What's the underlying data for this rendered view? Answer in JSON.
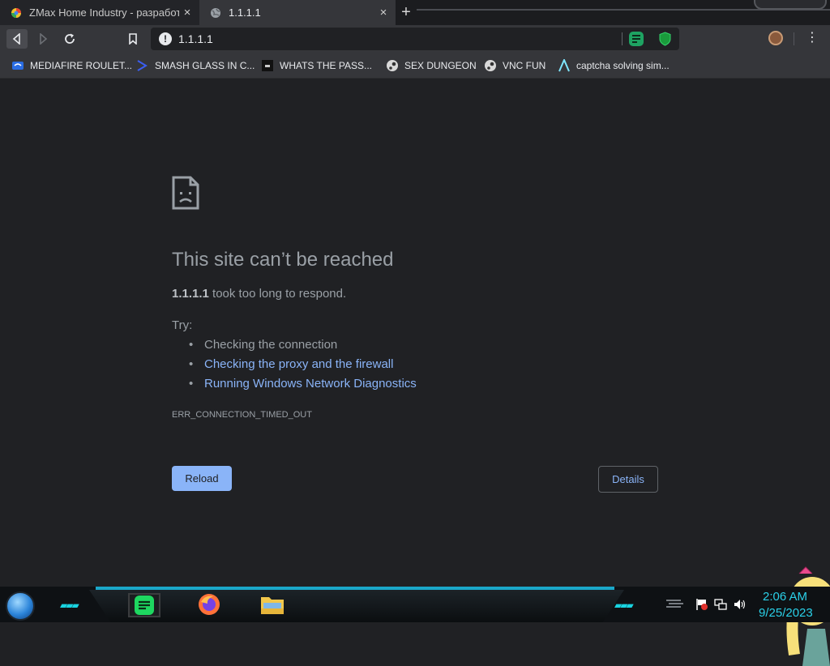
{
  "tabs": [
    {
      "title": "ZMax Home Industry - разработк",
      "close": "×",
      "favicon": "chrome-colorful-icon"
    },
    {
      "title": "1.1.1.1",
      "close": "×",
      "favicon": "globe-icon"
    }
  ],
  "new_tab": "+",
  "toolbar": {
    "url": "1.1.1.1",
    "security_icon": "!",
    "menu": "⋮"
  },
  "bookmarks": [
    {
      "label": "MEDIAFIRE ROULET...",
      "icon": "mediafire-icon"
    },
    {
      "label": "SMASH GLASS IN C...",
      "icon": "blue-arrow-icon"
    },
    {
      "label": "WHATS THE PASS...",
      "icon": "dark-app-icon"
    },
    {
      "label": "SEX DUNGEON",
      "icon": "steam-icon"
    },
    {
      "label": "VNC FUN",
      "icon": "steam-icon"
    },
    {
      "label": "captcha solving sim...",
      "icon": "lambda-icon"
    }
  ],
  "error_page": {
    "heading": "This site can’t be reached",
    "host": "1.1.1.1",
    "message": " took too long to respond.",
    "try_label": "Try:",
    "suggestions": [
      "Checking the connection",
      "Checking the proxy and the firewall",
      "Running Windows Network Diagnostics"
    ],
    "error_code": "ERR_CONNECTION_TIMED_OUT",
    "reload_label": "Reload",
    "details_label": "Details"
  },
  "taskbar": {
    "time": "2:06 AM",
    "date": "9/25/2023"
  },
  "colors": {
    "page_bg": "#202124",
    "toolbar_bg": "#35363a",
    "link": "#8ab4f8",
    "text_muted": "#9aa0a6",
    "clock": "#2ad0e8"
  }
}
